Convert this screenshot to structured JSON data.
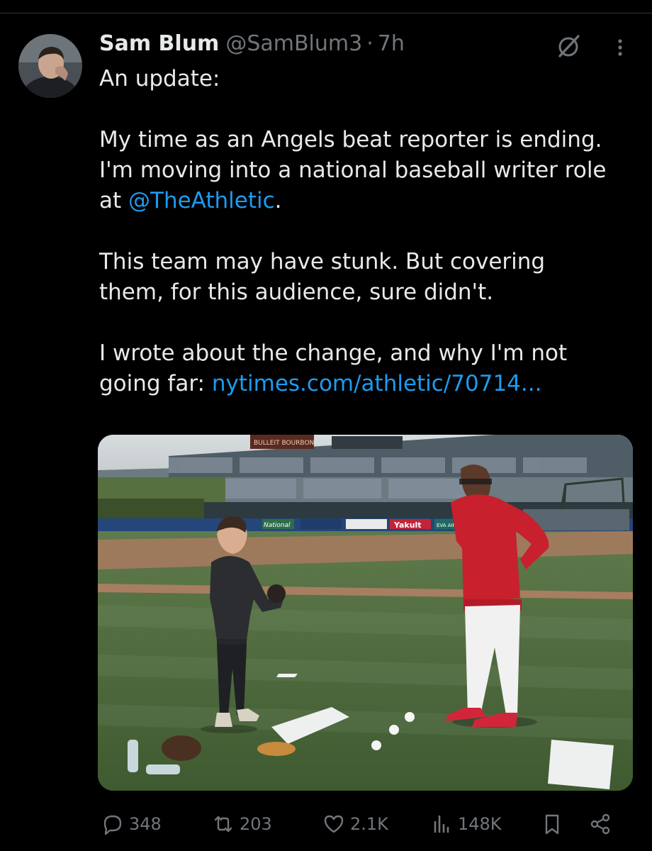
{
  "tweet": {
    "author_name": "Sam Blum",
    "handle": "@SamBlum3",
    "separator": "·",
    "time": "7h",
    "text": {
      "line1": "An update:",
      "line2": "My time as an Angels beat reporter is ending.",
      "line3": "I'm moving into a national baseball writer role",
      "line4_prefix": "at ",
      "line4_mention": "@TheAthletic",
      "line4_suffix": ".",
      "line5": "This team may have stunk. But covering",
      "line6": "them, for this audience, sure didn't.",
      "line7": "I wrote about the change, and why I'm not",
      "line8_prefix": "going far: ",
      "line8_link": "nytimes.com/athletic/70714..."
    },
    "media": {
      "type": "photo",
      "signs": {
        "bulleit": "BULLEIT BOURBON",
        "national": "National",
        "yakult": "Yakult",
        "evaair": "EVA AIR"
      }
    },
    "metrics": {
      "replies": "348",
      "retweets": "203",
      "likes": "2.1K",
      "views": "148K"
    }
  },
  "icons": {
    "grok": "grok-icon",
    "more": "more-icon",
    "reply": "reply-icon",
    "retweet": "retweet-icon",
    "like": "heart-icon",
    "views": "views-icon",
    "bookmark": "bookmark-icon",
    "share": "share-icon"
  },
  "colors": {
    "background": "#000000",
    "text": "#e7e9ea",
    "muted": "#71767b",
    "link": "#1d9bf0"
  }
}
